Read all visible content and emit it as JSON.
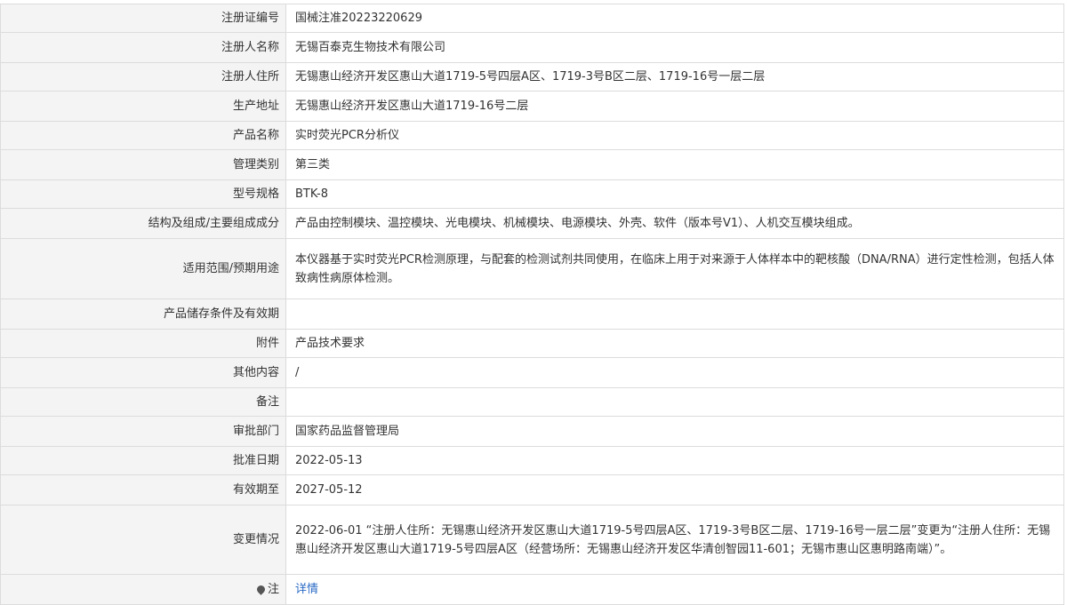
{
  "rows": [
    {
      "label": "注册证编号",
      "value": "国械注准20223220629"
    },
    {
      "label": "注册人名称",
      "value": "无锡百泰克生物技术有限公司"
    },
    {
      "label": "注册人住所",
      "value": "无锡惠山经济开发区惠山大道1719-5号四层A区、1719-3号B区二层、1719-16号一层二层"
    },
    {
      "label": "生产地址",
      "value": "无锡惠山经济开发区惠山大道1719-16号二层"
    },
    {
      "label": "产品名称",
      "value": "实时荧光PCR分析仪"
    },
    {
      "label": "管理类别",
      "value": "第三类"
    },
    {
      "label": "型号规格",
      "value": "BTK-8"
    },
    {
      "label": "结构及组成/主要组成成分",
      "value": "产品由控制模块、温控模块、光电模块、机械模块、电源模块、外壳、软件（版本号V1）、人机交互模块组成。"
    },
    {
      "label": "适用范围/预期用途",
      "value": "本仪器基于实时荧光PCR检测原理，与配套的检测试剂共同使用，在临床上用于对来源于人体样本中的靶核酸（DNA/RNA）进行定性检测，包括人体致病性病原体检测。"
    },
    {
      "label": "产品储存条件及有效期",
      "value": ""
    },
    {
      "label": "附件",
      "value": "产品技术要求"
    },
    {
      "label": "其他内容",
      "value": "/"
    },
    {
      "label": "备注",
      "value": ""
    },
    {
      "label": "审批部门",
      "value": "国家药品监督管理局"
    },
    {
      "label": "批准日期",
      "value": "2022-05-13"
    },
    {
      "label": "有效期至",
      "value": "2027-05-12"
    },
    {
      "label": "变更情况",
      "value": "2022-06-01 “注册人住所：无锡惠山经济开发区惠山大道1719-5号四层A区、1719-3号B区二层、1719-16号一层二层”变更为“注册人住所：无锡惠山经济开发区惠山大道1719-5号四层A区（经营场所：无锡惠山经济开发区华清创智园11-601；无锡市惠山区惠明路南端）”。"
    }
  ],
  "note": {
    "label": "注",
    "icon": "pin-icon",
    "link_text": "详情",
    "link_color": "#2a6ac6"
  }
}
